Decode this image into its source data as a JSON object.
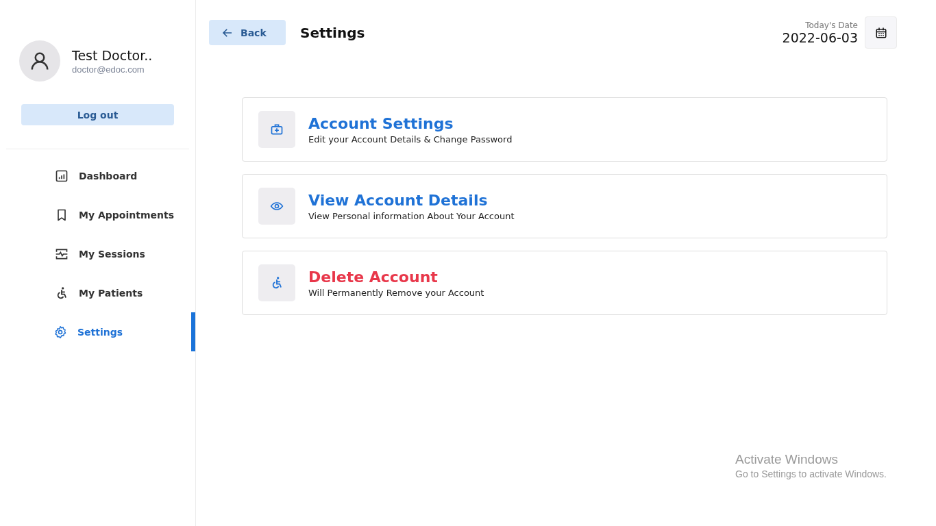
{
  "profile": {
    "name": "Test Doctor..",
    "email": "doctor@edoc.com"
  },
  "logout_button": "Log out",
  "nav": [
    {
      "label": "Dashboard",
      "selected": false
    },
    {
      "label": "My Appointments",
      "selected": false
    },
    {
      "label": "My Sessions",
      "selected": false
    },
    {
      "label": "My Patients",
      "selected": false
    },
    {
      "label": "Settings",
      "selected": true
    }
  ],
  "header": {
    "back_button": "Back",
    "title": "Settings",
    "date_label": "Today's Date",
    "date": "2022-06-03"
  },
  "options": [
    {
      "kind": "normal",
      "title": "Account Settings",
      "subtitle": "Edit your Account Details & Change Password"
    },
    {
      "kind": "normal",
      "title": "View Account Details",
      "subtitle": "View Personal information About Your Account"
    },
    {
      "kind": "danger",
      "title": "Delete Account",
      "subtitle": "Will Permanently Remove your Account"
    }
  ],
  "os_notice": {
    "title": "Activate Windows",
    "text": "Go to Settings to activate Windows."
  }
}
